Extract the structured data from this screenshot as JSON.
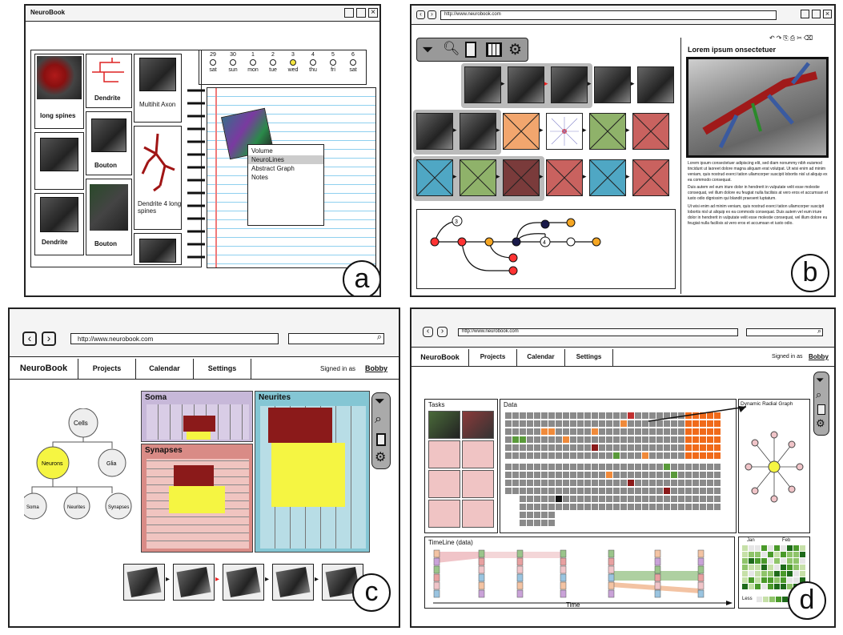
{
  "panel_a": {
    "label": "a",
    "window_title": "NeuroBook",
    "thumbs": [
      {
        "label": "long spines"
      },
      {
        "label": "Dendrite"
      },
      {
        "label": "Multihit Axon"
      },
      {
        "label": "Bouton"
      },
      {
        "label": "Dendrite 4 long spines"
      },
      {
        "label": "Dendrite"
      },
      {
        "label": "Bouton"
      }
    ],
    "calendar": [
      {
        "day": "29",
        "dow": "sat"
      },
      {
        "day": "30",
        "dow": "sun"
      },
      {
        "day": "1",
        "dow": "mon"
      },
      {
        "day": "2",
        "dow": "tue"
      },
      {
        "day": "3",
        "dow": "wed"
      },
      {
        "day": "4",
        "dow": "thu"
      },
      {
        "day": "5",
        "dow": "fri"
      },
      {
        "day": "6",
        "dow": "sat"
      }
    ],
    "context_menu": [
      "Volume",
      "NeuroLines",
      "Abstract Graph",
      "Notes"
    ],
    "menu_selected": "NeuroLines"
  },
  "panel_b": {
    "label": "b",
    "url": "http://www.neurobook.com",
    "article_title": "Lorem ipsum onsectetuer",
    "article_body": "Lorem ipsum consectetuer adipiscing elit, sed diam nonummy nibh euismod tincidunt ut laoreet dolore magna aliquam erat volutpat. Ut wisi enim ad minim veniam, quis nostrud exerci tation ullamcorper suscipit lobortis nisl ut aliquip ex ea commodo consequat.",
    "article_body2": "Duis autem vel eum iriure dolor in hendrerit in vulputate velit esse molestie consequat, vel illum dolore eu feugiat nulla facilisis at vero eros et accumsan et iusto odio dignissim qui blandit praesent luptatum.",
    "article_body3": "Ut wisi enim ad minim veniam, quis nostrud exerci tation ullamcorper suscipit lobortis nisl ut aliquip ex ea commodo consequat. Duis autem vel eum iriure dolor in hendrerit in vulputate velit esse molestie consequat, vel illum dolore eu feugiat nulla facilisis at vero eros et accumsan et iusto odio.",
    "graph_nodes": [
      "3",
      "4"
    ],
    "row_colors": [
      "#f2a66e",
      "#8fb26a",
      "#c9625f",
      "#4fa7c4",
      "#7a3b3b"
    ]
  },
  "panel_c": {
    "label": "c",
    "url": "http://www.neurobook.com",
    "nav": [
      "NeuroBook",
      "Projects",
      "Calendar",
      "Settings"
    ],
    "signed_in_prefix": "Signed in as",
    "user": "Bobby",
    "tree": {
      "root": "Cells",
      "level1": [
        "Neurons",
        "Glia"
      ],
      "level2": [
        "Soma",
        "Neurites",
        "Synapses"
      ]
    },
    "treemap": {
      "soma": "Soma",
      "synapses": "Synapses",
      "neurites": "Neurites"
    },
    "colors": {
      "soma": "#c7b8d9",
      "synapses": "#d98b86",
      "neurites": "#84c6d4",
      "dark": "#8b1a1a",
      "yellow": "#f5f542"
    }
  },
  "panel_d": {
    "label": "d",
    "url": "http://www.neurobook.com",
    "nav": [
      "NeuroBook",
      "Projects",
      "Calendar",
      "Settings"
    ],
    "signed_in_prefix": "Signed in as",
    "user": "Bobby",
    "tasks_title": "Tasks",
    "data_title": "Data",
    "radial_title": "Dynamic Radial Graph",
    "timeline_title": "TimeLine (data)",
    "time_label": "Time",
    "calendar_months": [
      "Jan",
      "Feb"
    ],
    "calendar_legend": "Less"
  }
}
